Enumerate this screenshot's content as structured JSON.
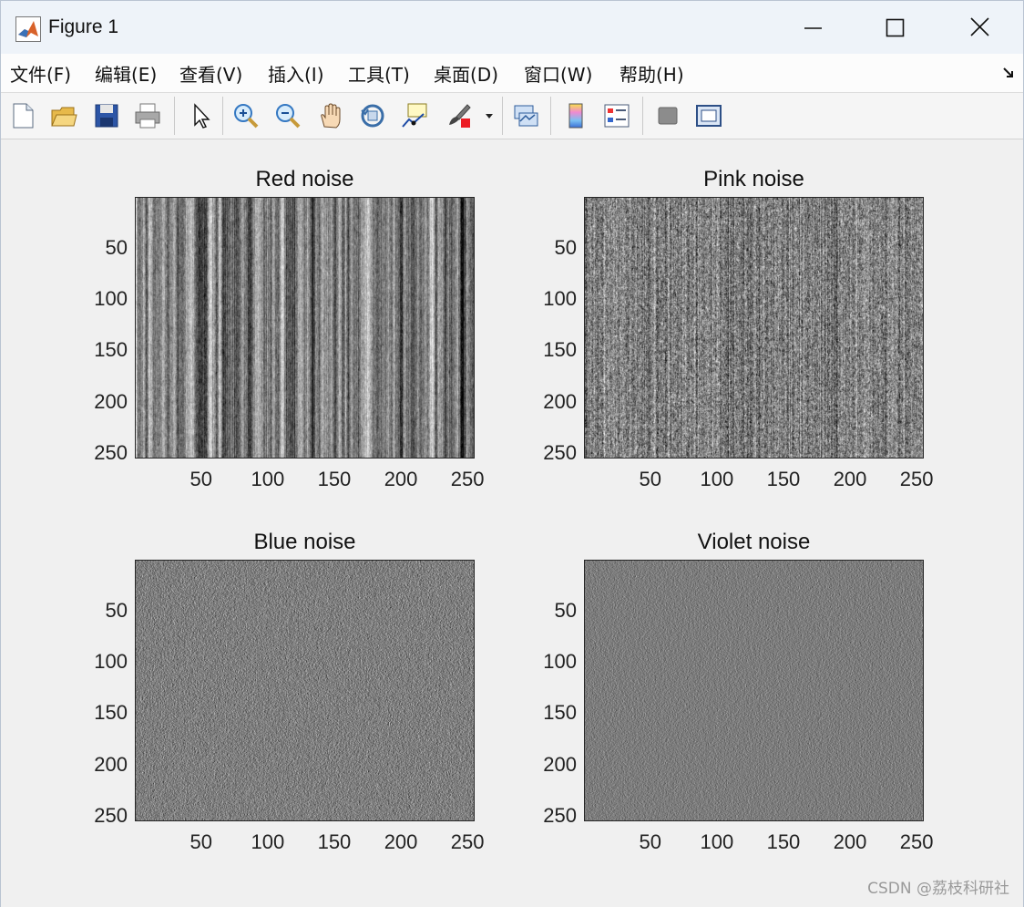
{
  "window": {
    "title": "Figure 1"
  },
  "menu": [
    {
      "name": "menu-file",
      "label": "文件(F)"
    },
    {
      "name": "menu-edit",
      "label": "编辑(E)"
    },
    {
      "name": "menu-view",
      "label": "查看(V)"
    },
    {
      "name": "menu-insert",
      "label": "插入(I)"
    },
    {
      "name": "menu-tools",
      "label": "工具(T)"
    },
    {
      "name": "menu-desktop",
      "label": "桌面(D)"
    },
    {
      "name": "menu-window",
      "label": "窗口(W)"
    },
    {
      "name": "menu-help",
      "label": "帮助(H)"
    }
  ],
  "toolbar": [
    "new-figure-icon",
    "open-file-icon",
    "save-icon",
    "print-icon",
    "pointer-icon",
    "zoom-in-icon",
    "zoom-out-icon",
    "pan-hand-icon",
    "rotate-3d-icon",
    "data-cursor-icon",
    "brush-icon",
    "brush-dropdown-icon",
    "link-plot-icon",
    "colorbar-icon",
    "legend-icon",
    "hide-plot-tools-icon",
    "show-plot-tools-icon"
  ],
  "chart_data": [
    {
      "type": "heatmap",
      "title": "Red noise",
      "colormap": "gray",
      "xticks": [
        "50",
        "100",
        "150",
        "200",
        "250"
      ],
      "yticks": [
        "50",
        "100",
        "150",
        "200",
        "250"
      ],
      "xlim": [
        1,
        256
      ],
      "ylim": [
        1,
        256
      ],
      "y_reversed": true
    },
    {
      "type": "heatmap",
      "title": "Pink noise",
      "colormap": "gray",
      "xticks": [
        "50",
        "100",
        "150",
        "200",
        "250"
      ],
      "yticks": [
        "50",
        "100",
        "150",
        "200",
        "250"
      ],
      "xlim": [
        1,
        256
      ],
      "ylim": [
        1,
        256
      ],
      "y_reversed": true
    },
    {
      "type": "heatmap",
      "title": "Blue noise",
      "colormap": "gray",
      "xticks": [
        "50",
        "100",
        "150",
        "200",
        "250"
      ],
      "yticks": [
        "50",
        "100",
        "150",
        "200",
        "250"
      ],
      "xlim": [
        1,
        256
      ],
      "ylim": [
        1,
        256
      ],
      "y_reversed": true
    },
    {
      "type": "heatmap",
      "title": "Violet noise",
      "colormap": "gray",
      "xticks": [
        "50",
        "100",
        "150",
        "200",
        "250"
      ],
      "yticks": [
        "50",
        "100",
        "150",
        "200",
        "250"
      ],
      "xlim": [
        1,
        256
      ],
      "ylim": [
        1,
        256
      ],
      "y_reversed": true
    }
  ],
  "watermark": "CSDN @荔枝科研社"
}
